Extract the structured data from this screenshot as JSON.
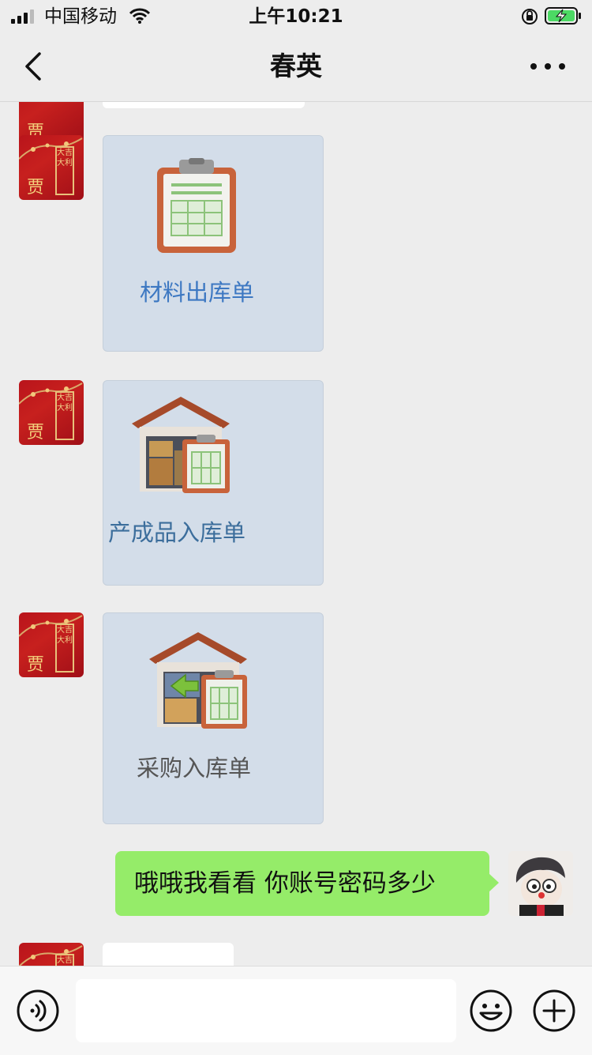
{
  "status_bar": {
    "carrier": "中国移动",
    "time": "上午10:21"
  },
  "nav": {
    "title": "春英"
  },
  "messages": {
    "card1_label": "材料出库单",
    "card2_label": "产成品入库单",
    "card3_label": "采购入库单",
    "my_text": "哦哦我看看 你账号密码多少"
  },
  "avatar_left": {
    "text_vertical": "大吉大利",
    "text_big": "贾"
  },
  "icons": {
    "back": "chevron-left-icon",
    "more": "more-dots-icon",
    "voice": "voice-icon",
    "emoji": "emoji-icon",
    "plus": "plus-icon"
  },
  "colors": {
    "my_bubble": "#95ec69",
    "card_bg": "#d3dde9",
    "card1_label": "#3d78c2",
    "card2_label": "#3c6e9c",
    "card3_label": "#555555",
    "battery": "#4cd964"
  }
}
